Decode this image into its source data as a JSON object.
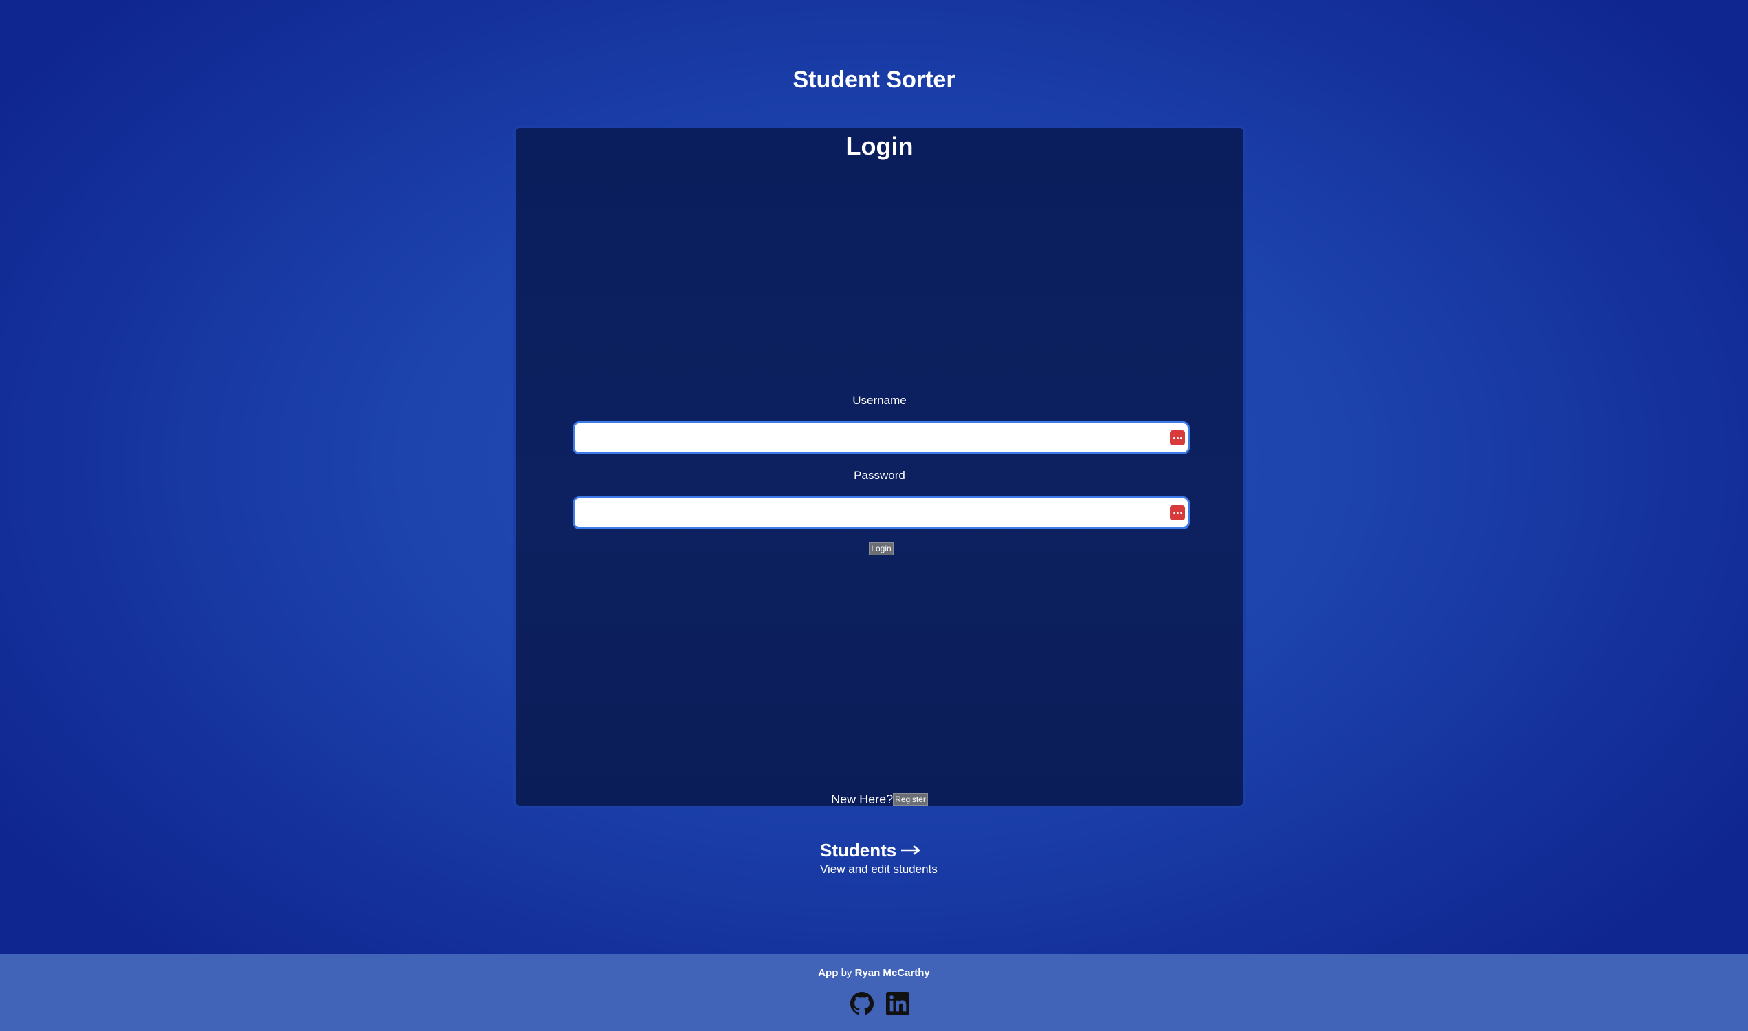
{
  "header": {
    "app_title": "Student Sorter"
  },
  "login_card": {
    "heading": "Login",
    "username": {
      "label": "Username",
      "value": "",
      "placeholder": ""
    },
    "password": {
      "label": "Password",
      "value": "",
      "placeholder": ""
    },
    "login_button": "Login",
    "register_prompt": "New Here?",
    "register_button": "Register"
  },
  "students_link": {
    "title": "Students",
    "arrow": "→",
    "description": "View and edit students"
  },
  "footer": {
    "app_label": "App",
    "by_text": "by",
    "author": "Ryan McCarthy",
    "icons": [
      "github-icon",
      "linkedin-icon"
    ]
  },
  "colors": {
    "background": "#1d43ad",
    "card": "#0b1e5c",
    "footer": "#4264b8",
    "input_border": "#3d7be8",
    "password_manager_icon": "#d83b3b",
    "button": "#6b6e75"
  }
}
